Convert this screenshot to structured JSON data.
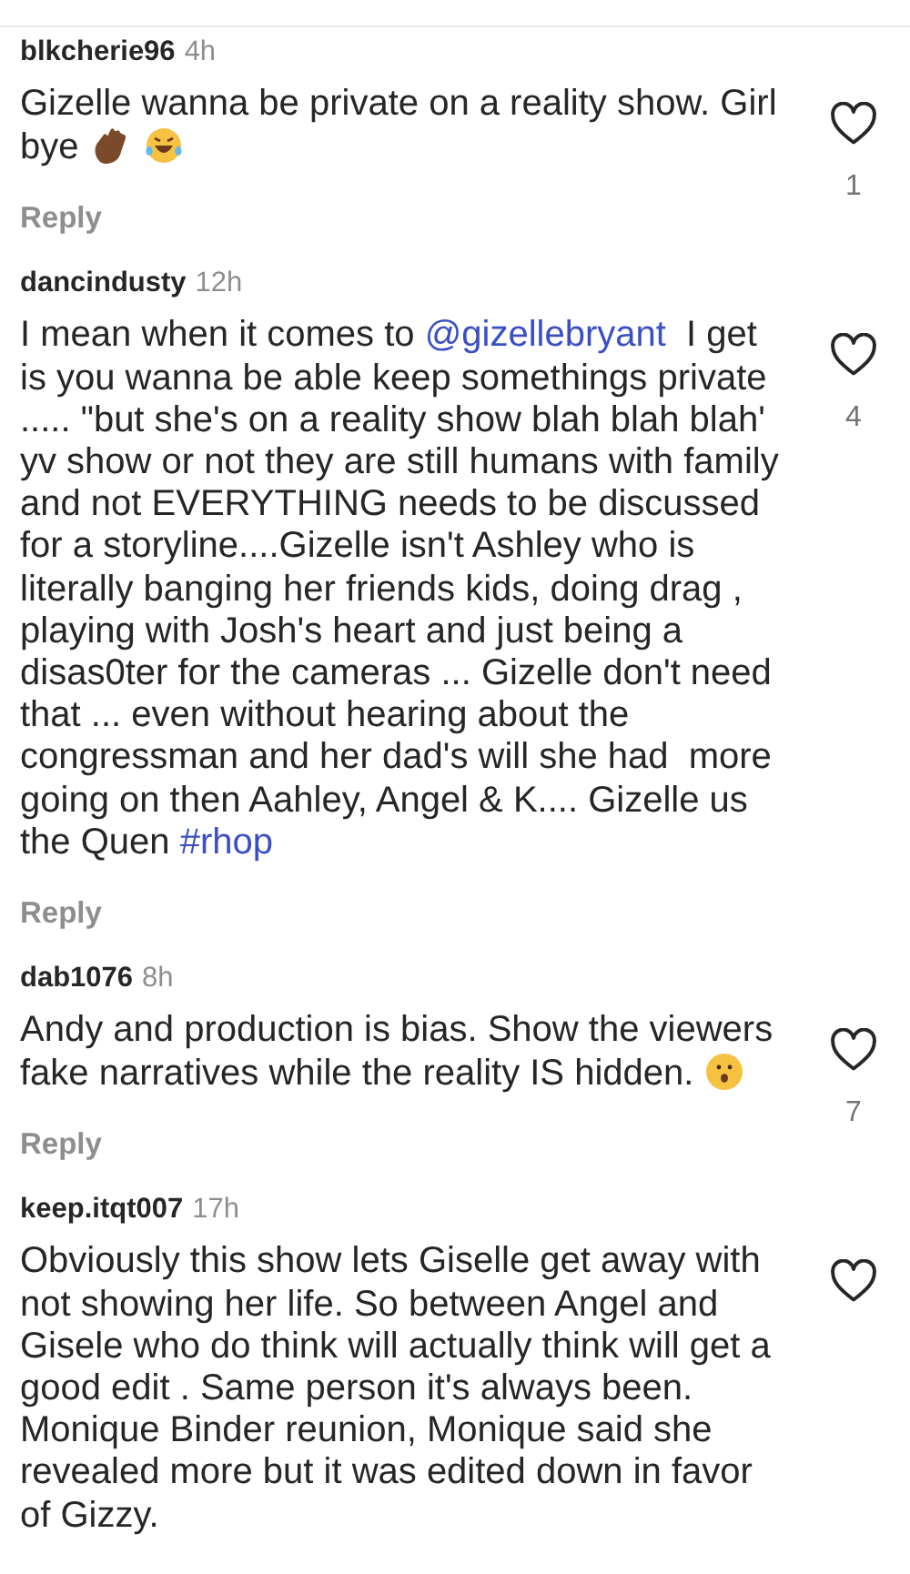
{
  "comments": [
    {
      "username": "blkcherie96",
      "time": "4h",
      "body": [
        {
          "kind": "text",
          "text": "Gizelle wanna be private on a reality show. Girl bye "
        },
        {
          "kind": "waving-hand"
        },
        {
          "kind": "laughing-face"
        }
      ],
      "liked": false,
      "likes": "1",
      "reply": "Reply"
    },
    {
      "username": "dancindusty",
      "time": "12h",
      "body": [
        {
          "kind": "text",
          "text": "I mean when it comes to "
        },
        {
          "kind": "mention",
          "text": "@gizellebryant"
        },
        {
          "kind": "text",
          "text": "  I get is you wanna be able keep somethings private ..... \"but she's on a reality show blah blah blah'  yv show or not they are still humans with family and not EVERYTHING needs to be discussed for a storyline....Gizelle isn't Ashley who is literally banging her friends kids, doing drag , playing with Josh's heart and just being a disas0ter for the cameras ... Gizelle don't need that ... even without hearing about the congressman and her dad's will she had  more going on then Aahley, Angel & K.... Gizelle us the Quen "
        },
        {
          "kind": "hashtag",
          "text": "#rhop"
        }
      ],
      "liked": false,
      "likes": "4",
      "reply": "Reply"
    },
    {
      "username": "dab1076",
      "time": "8h",
      "body": [
        {
          "kind": "text",
          "text": "Andy and production is bias. Show the viewers fake narratives while the reality IS hidden. "
        },
        {
          "kind": "surprised-face"
        }
      ],
      "liked": false,
      "likes": "7",
      "reply": "Reply"
    },
    {
      "username": "keep.itqt007",
      "time": "17h",
      "body": [
        {
          "kind": "text",
          "text": "Obviously this show lets Giselle get away with not showing her life. So between Angel and Gisele who do think will actually think will get a good edit . Same person it's always been.  Monique Binder reunion, Monique said she revealed more but it was edited down in favor of Gizzy."
        }
      ],
      "liked": false
    }
  ]
}
